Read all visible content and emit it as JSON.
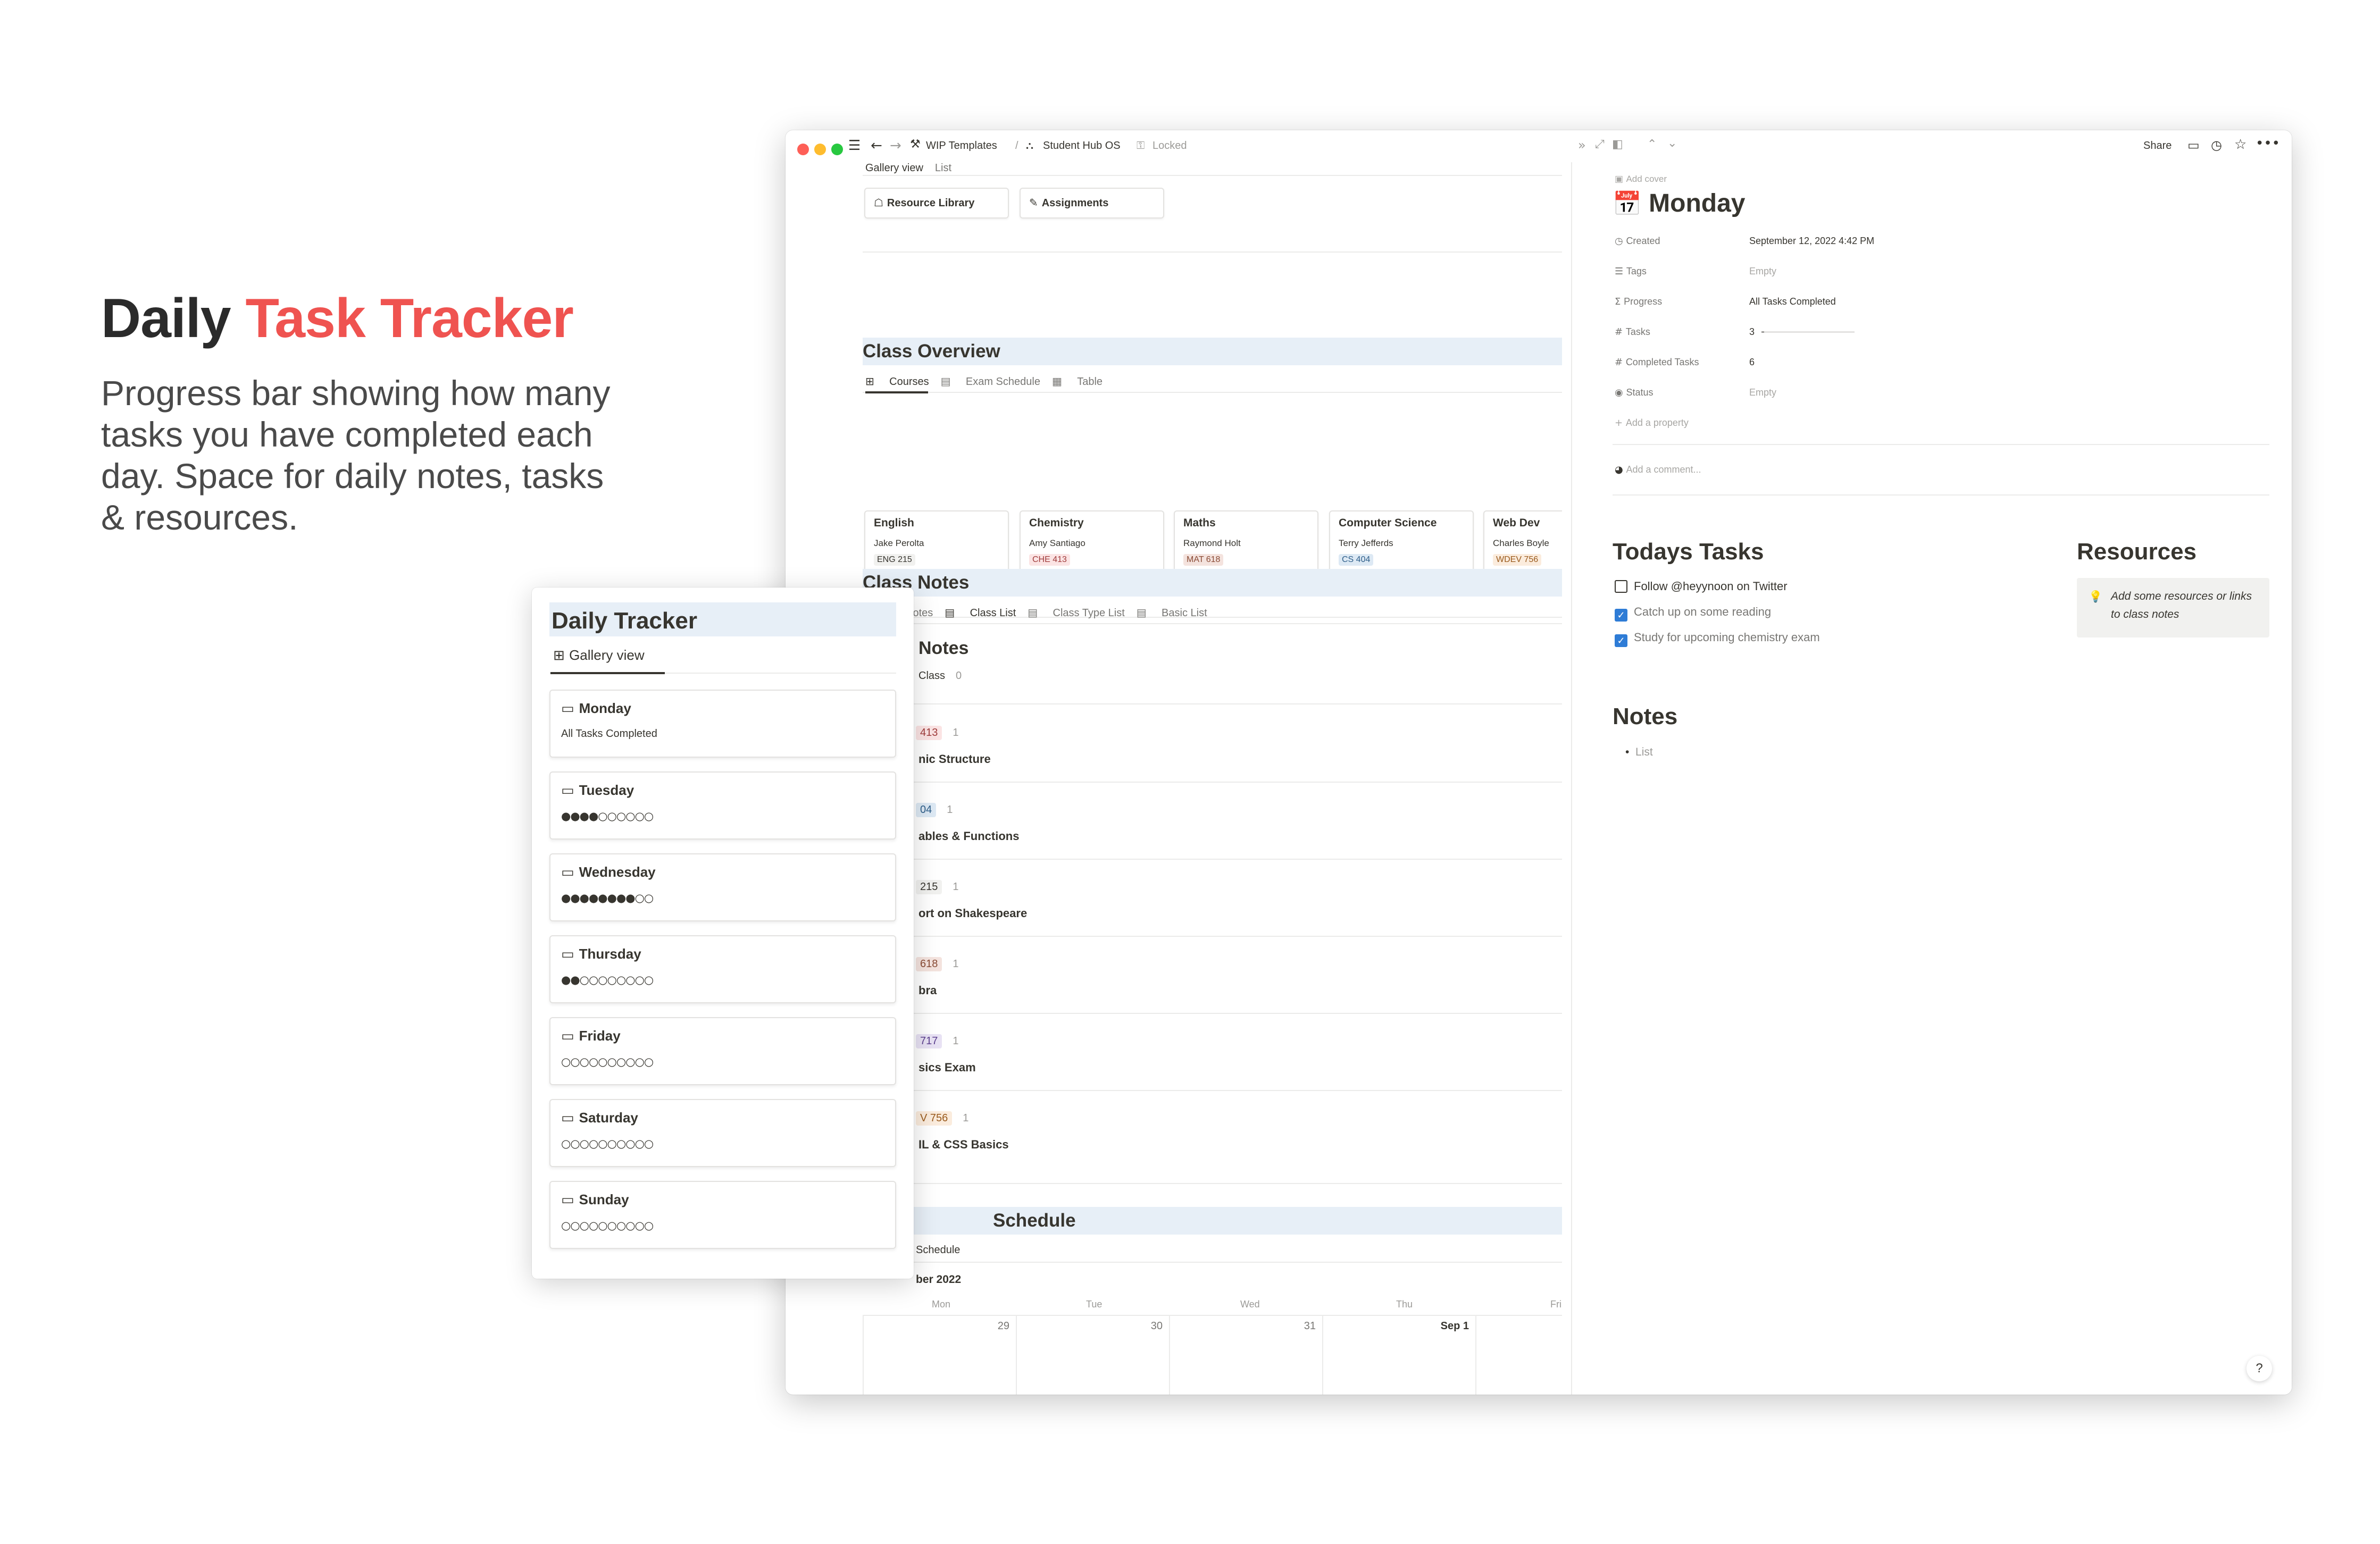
{
  "hero": {
    "title_part1": "Daily",
    "title_part2": "Task Tracker",
    "description": "Progress bar showing how many tasks you have completed each day. Space for daily notes, tasks & resources."
  },
  "colors": {
    "accent": "#ef5350",
    "header_band": "#e7eff7",
    "checkbox": "#2e7cd6"
  },
  "window": {
    "breadcrumb": [
      "WIP Templates",
      "/",
      "Student Hub OS"
    ],
    "locked_label": "Locked",
    "share_label": "Share"
  },
  "main": {
    "top_tabs": [
      "Gallery view",
      "List"
    ],
    "buttons": [
      "Resource Library",
      "Assignments"
    ],
    "class_overview": {
      "title": "Class Overview",
      "tabs": [
        "Courses",
        "Exam Schedule",
        "Table"
      ],
      "courses": [
        {
          "name": "English",
          "teacher": "Jake Perolta",
          "code": "ENG 215"
        },
        {
          "name": "Chemistry",
          "teacher": "Amy Santiago",
          "code": "CHE 413"
        },
        {
          "name": "Maths",
          "teacher": "Raymond Holt",
          "code": "MAT 618"
        },
        {
          "name": "Computer Science",
          "teacher": "Terry Jefferds",
          "code": "CS 404"
        },
        {
          "name": "Web Dev",
          "teacher": "Charles Boyle",
          "code": "WDEV 756"
        }
      ]
    },
    "class_notes": {
      "title": "Class Notes",
      "tabs": [
        "All Notes",
        "Class List",
        "Class Type List",
        "Basic List"
      ],
      "subtitle": "Notes",
      "no_class": {
        "label": "Class",
        "count": "0"
      },
      "groups": [
        {
          "tag": "413",
          "count": "1",
          "note": "nic Structure"
        },
        {
          "tag": "04",
          "count": "1",
          "note": "ables & Functions"
        },
        {
          "tag": "215",
          "count": "1",
          "note": "ort on Shakespeare"
        },
        {
          "tag": "618",
          "count": "1",
          "note": "bra"
        },
        {
          "tag": "717",
          "count": "1",
          "note": "sics Exam"
        },
        {
          "tag": "V 756",
          "count": "1",
          "note": "IL & CSS Basics"
        }
      ]
    },
    "schedule": {
      "title": "Schedule",
      "tab": "Schedule",
      "month": "ber 2022",
      "weekdays": [
        "Mon",
        "Tue",
        "Wed",
        "Thu",
        "Fri"
      ],
      "dates": [
        "29",
        "30",
        "31",
        "Sep 1",
        ""
      ]
    }
  },
  "panel": {
    "add_cover": "Add cover",
    "page_title": "Monday",
    "properties": [
      {
        "name": "Created",
        "value": "September 12, 2022 4:42 PM",
        "empty": false
      },
      {
        "name": "Tags",
        "value": "Empty",
        "empty": true
      },
      {
        "name": "Progress",
        "value": "All Tasks Completed",
        "empty": false
      },
      {
        "name": "Tasks",
        "value": "3",
        "empty": false
      },
      {
        "name": "Completed Tasks",
        "value": "6",
        "empty": false
      },
      {
        "name": "Status",
        "value": "Empty",
        "empty": true
      }
    ],
    "add_property": "Add a property",
    "add_comment": "Add a comment...",
    "todays_tasks": {
      "title": "Todays Tasks",
      "items": [
        {
          "label": "Follow @heyynoon on Twitter",
          "checked": false
        },
        {
          "label": "Catch up on some reading",
          "checked": true
        },
        {
          "label": "Study for upcoming chemistry exam",
          "checked": true
        }
      ]
    },
    "resources": {
      "title": "Resources",
      "callout": "Add some resources or links to class notes"
    },
    "notes": {
      "title": "Notes",
      "list_item": "List"
    },
    "help": "?"
  },
  "tracker": {
    "title": "Daily Tracker",
    "view": "Gallery view",
    "days": [
      {
        "name": "Monday",
        "progress": "All Tasks Completed"
      },
      {
        "name": "Tuesday",
        "progress": "●●●●○○○○○○"
      },
      {
        "name": "Wednesday",
        "progress": "●●●●●●●●○○"
      },
      {
        "name": "Thursday",
        "progress": "●●○○○○○○○○"
      },
      {
        "name": "Friday",
        "progress": "○○○○○○○○○○"
      },
      {
        "name": "Saturday",
        "progress": "○○○○○○○○○○"
      },
      {
        "name": "Sunday",
        "progress": "○○○○○○○○○○"
      }
    ]
  }
}
